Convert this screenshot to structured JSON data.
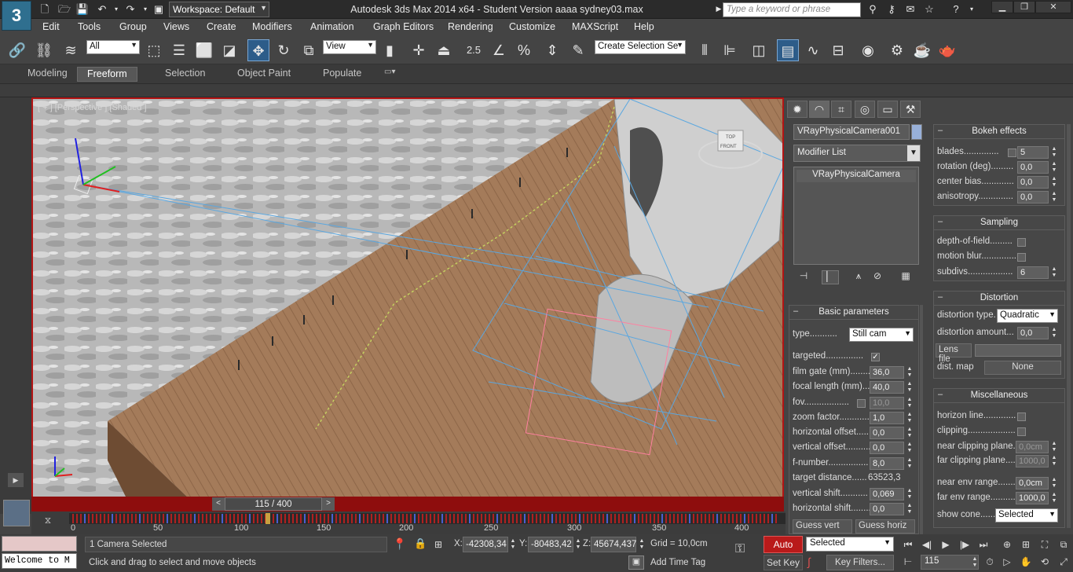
{
  "titlebar": {
    "workspace": "Workspace: Default",
    "title": "Autodesk 3ds Max  2014 x64  - Student Version    aaaa sydney03.max",
    "search_placeholder": "Type a keyword or phrase"
  },
  "menu": [
    "Edit",
    "Tools",
    "Group",
    "Views",
    "Create",
    "Modifiers",
    "Animation",
    "Graph Editors",
    "Rendering",
    "Customize",
    "MAXScript",
    "Help"
  ],
  "toolbar": {
    "filter_value": "All",
    "refcoord_value": "View",
    "selection_set_placeholder": "Create Selection Se",
    "snap_label": "2.5"
  },
  "ribbon_tabs": [
    "Modeling",
    "Freeform",
    "Selection",
    "Object Paint",
    "Populate"
  ],
  "viewport": {
    "label": "[ + ] [Perspective ] [Shaded ]",
    "viewcube_top": "TOP",
    "viewcube_front": "FRONT"
  },
  "time_slider": {
    "label": "115 / 400"
  },
  "trackbar": {
    "ticks": [
      "0",
      "50",
      "100",
      "150",
      "200",
      "250",
      "300",
      "350",
      "400"
    ]
  },
  "cmd": {
    "object_name": "VRayPhysicalCamera001",
    "modifier_list": "Modifier List",
    "stack_item": "VRayPhysicalCamera"
  },
  "basic": {
    "title": "Basic parameters",
    "type_label": "type...........",
    "type_value": "Still cam",
    "targeted": "targeted...............",
    "film_gate": "film gate (mm)..........",
    "film_gate_val": "36,0",
    "focal_length": "focal length (mm)......",
    "focal_length_val": "40,0",
    "fov": "fov..................",
    "fov_val": "10,0",
    "zoom": "zoom factor.............",
    "zoom_val": "1,0",
    "h_offset": "horizontal offset.......",
    "h_offset_val": "0,0",
    "v_offset": "vertical offset..........",
    "v_offset_val": "0,0",
    "fnumber": "f-number................",
    "fnumber_val": "8,0",
    "target_distance": "target distance......",
    "target_distance_val": "63523,3",
    "v_shift": "vertical shift...........",
    "v_shift_val": "0,069",
    "h_shift": "horizontal shift.........",
    "h_shift_val": "0,0",
    "guess": "Guess vert",
    "guess2": "Guess horiz"
  },
  "bokeh": {
    "title": "Bokeh effects",
    "blades": "blades..............",
    "blades_val": "5",
    "rotation": "rotation (deg).........",
    "rotation_val": "0,0",
    "center_bias": "center bias..............",
    "center_bias_val": "0,0",
    "anisotropy": "anisotropy..............",
    "anisotropy_val": "0,0"
  },
  "sampling": {
    "title": "Sampling",
    "dof": "depth-of-field.........",
    "motion_blur": "motion blur..............",
    "subdivs": "subdivs..................",
    "subdivs_val": "6"
  },
  "distortion": {
    "title": "Distortion",
    "type": "distortion type.",
    "type_val": "Quadratic",
    "amount": "distortion amount...",
    "amount_val": "0,0",
    "lens_file": "Lens file",
    "dist_map": "dist. map",
    "dist_map_val": "None"
  },
  "misc": {
    "title": "Miscellaneous",
    "horizon": "horizon line..............",
    "clipping": "clipping...................",
    "near_clip": "near clipping plane...",
    "near_clip_val": "0,0cm",
    "far_clip": "far clipping plane....",
    "far_clip_val": "1000,0",
    "near_env": "near env range.......",
    "near_env_val": "0,0cm",
    "far_env": "far env range..........",
    "far_env_val": "1000,0",
    "show_cone": "show cone..........",
    "show_cone_val": "Selected"
  },
  "status": {
    "listener": "Welcome to M",
    "selection": "1 Camera Selected",
    "prompt": "Click and drag to select and move objects",
    "x_label": "X:",
    "x_val": "-42308,34",
    "y_label": "Y:",
    "y_val": "-80483,42",
    "z_label": "Z:",
    "z_val": "45674,437",
    "grid": "Grid = 10,0cm",
    "add_time_tag": "Add Time Tag",
    "auto_key": "Auto Key",
    "set_key": "Set Key",
    "key_mode": "Selected",
    "key_filters": "Key Filters...",
    "frame": "115"
  }
}
